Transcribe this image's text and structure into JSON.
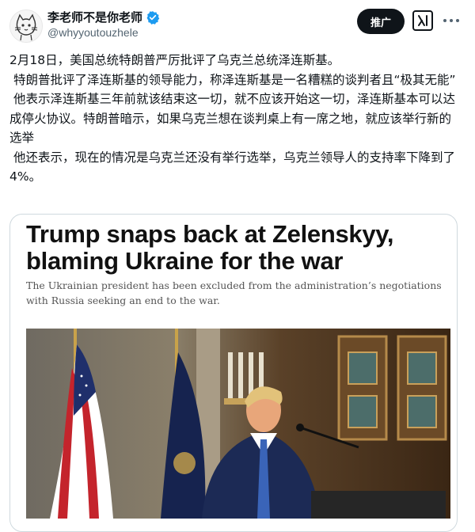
{
  "author": {
    "display_name": "李老师不是你老师",
    "handle": "@whyyoutouzhele"
  },
  "header": {
    "promote_label": "推广"
  },
  "tweet": {
    "lines": [
      "2月18日，美国总统特朗普严厉批评了乌克兰总统泽连斯基。",
      " 特朗普批评了泽连斯基的领导能力，称泽连斯基是一名糟糕的谈判者且“极其无能”",
      " 他表示泽连斯基三年前就该结束这一切，就不应该开始这一切，泽连斯基本可以达成停火协议。特朗普暗示，如果乌克兰想在谈判桌上有一席之地，就应该举行新的选举",
      " 他还表示，现在的情况是乌克兰还没有举行选举，乌克兰领导人的支持率下降到了4%。"
    ]
  },
  "card": {
    "headline": "Trump snaps back at Zelenskyy, blaming Ukraine for the war",
    "subheadline": "The Ukrainian president has been excluded from the administration’s negotiations with Russia seeking an end to the war."
  },
  "colors": {
    "text": "#0f1419",
    "secondary": "#536471",
    "verified": "#1d9bf0",
    "button_dark": "#0f1419",
    "card_border": "#cfd9de"
  },
  "icons": {
    "verified": "verified-badge-icon",
    "grok": "grok-icon",
    "more": "more-icon"
  }
}
